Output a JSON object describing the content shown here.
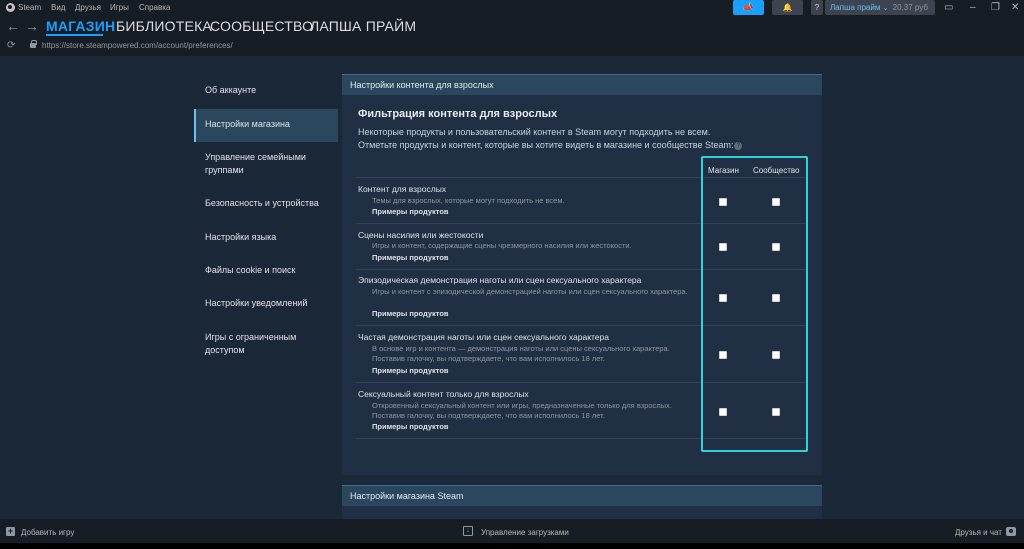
{
  "menubar": {
    "items": [
      "Steam",
      "Вид",
      "Друзья",
      "Игры",
      "Справка"
    ],
    "account_name": "Лапша прайм",
    "account_balance": "20,37 руб",
    "help_label": "?"
  },
  "nav": {
    "tabs": [
      "МАГАЗИН",
      "БИБЛИОТЕКА",
      "СООБЩЕСТВО",
      "ЛАПША ПРАЙМ"
    ],
    "active_tab": "МАГАЗИН",
    "url": "https://store.steampowered.com/account/preferences/"
  },
  "sidebar": {
    "items": [
      {
        "label": "Об аккаунте",
        "active": false
      },
      {
        "label": "Настройки магазина",
        "active": true
      },
      {
        "label": "Управление семейными группами",
        "active": false
      },
      {
        "label": "Безопасность и устройства",
        "active": false
      },
      {
        "label": "Настройки языка",
        "active": false
      },
      {
        "label": "Файлы cookie и поиск",
        "active": false
      },
      {
        "label": "Настройки уведомлений",
        "active": false
      },
      {
        "label": "Игры с ограниченным доступом",
        "active": false
      }
    ]
  },
  "main": {
    "header": "Настройки контента для взрослых",
    "section_title": "Фильтрация контента для взрослых",
    "desc_line1": "Некоторые продукты и пользовательский контент в Steam могут подходить не всем.",
    "desc_line2": "Отметьте продукты и контент, которые вы хотите видеть в магазине и сообществе Steam:",
    "columns": {
      "store": "Магазин",
      "community": "Сообщество"
    },
    "rows": [
      {
        "title": "Контент для взрослых",
        "description": "Темы для взрослых, которые могут подходить не всем.",
        "link": "Примеры продуктов",
        "store_checked": false,
        "community_checked": false
      },
      {
        "title": "Сцены насилия или жестокости",
        "description": "Игры и контент, содержащие сцены чрезмерного насилия или жестокости.",
        "link": "Примеры продуктов",
        "store_checked": false,
        "community_checked": false
      },
      {
        "title": "Эпизодическая демонстрация наготы или сцен сексуального характера",
        "description": "Игры и контент с эпизодической демонстрацией наготы или сцен сексуального характера.",
        "link": "Примеры продуктов",
        "store_checked": false,
        "community_checked": false
      },
      {
        "title": "Частая демонстрация наготы или сцен сексуального характера",
        "description": "В основе игр и контента — демонстрация наготы или сцены сексуального характера. Поставив галочку, вы подтверждаете, что вам исполнилось 18 лет.",
        "link": "Примеры продуктов",
        "store_checked": false,
        "community_checked": false
      },
      {
        "title": "Сексуальный контент только для взрослых",
        "description": "Откровенный сексуальный контент или игры, предназначенные только для взрослых. Поставив галочку, вы подтверждаете, что вам исполнилось 18 лет.",
        "link": "Примеры продуктов",
        "store_checked": false,
        "community_checked": false
      }
    ],
    "second_header": "Настройки магазина Steam"
  },
  "bottombar": {
    "add_game": "Добавить игру",
    "downloads": "Управление загрузками",
    "friends": "Друзья и чат"
  },
  "colors": {
    "accent": "#1a9fff",
    "highlight": "#2fd3d8",
    "background": "#1b2838",
    "panel": "#202f43"
  }
}
